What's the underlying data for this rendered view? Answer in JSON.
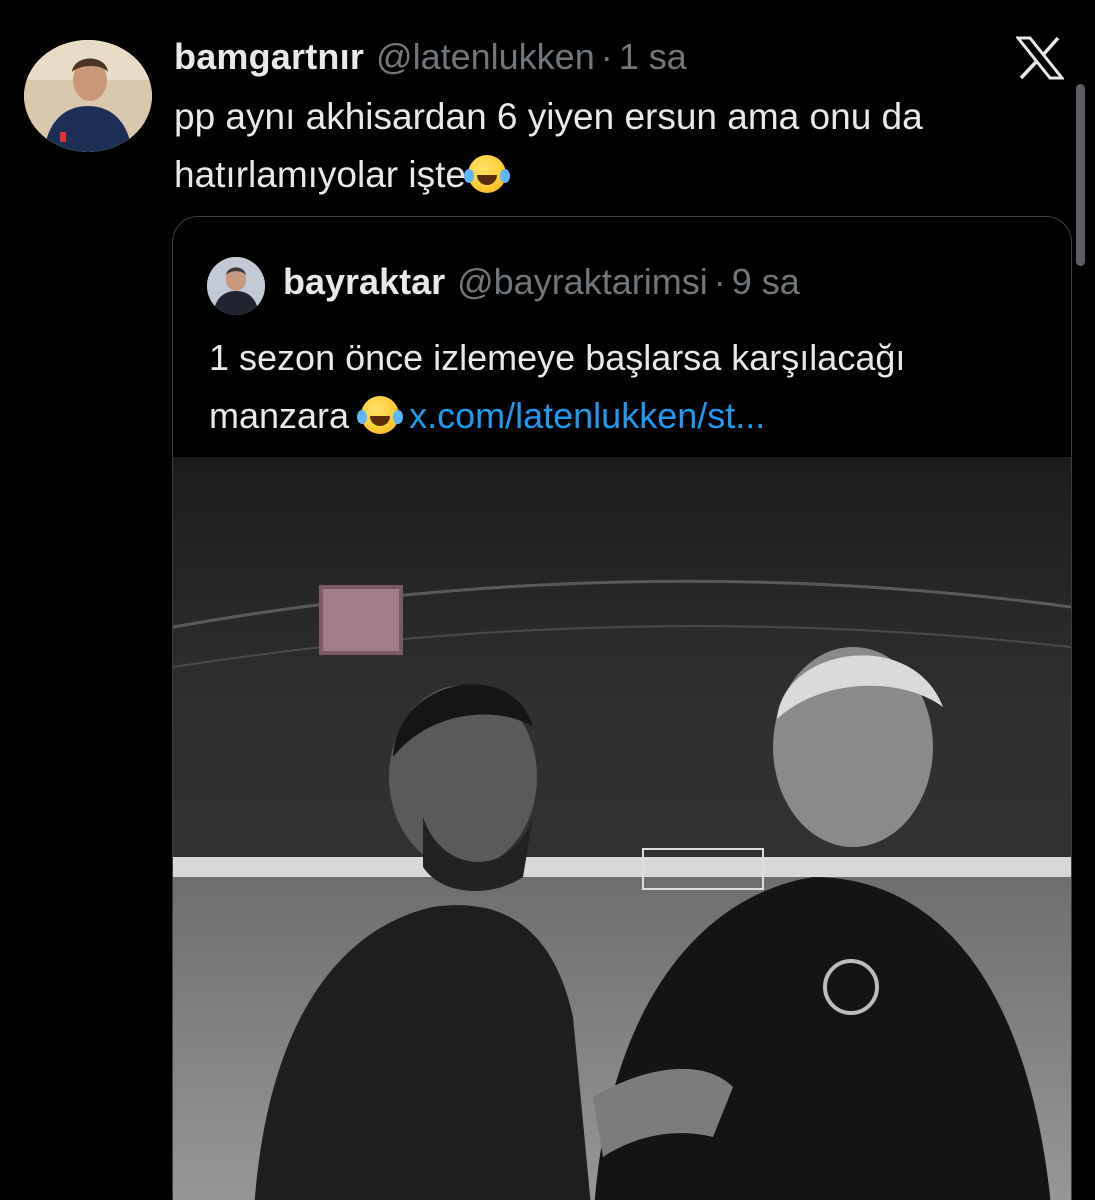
{
  "tweet": {
    "display_name": "bamgartnır",
    "handle": "@latenlukken",
    "separator": "·",
    "time": "1 sa",
    "text": "pp aynı akhisardan 6 yiyen ersun ama onu da hatırlamıyolar işte",
    "emoji": "face-with-tears-of-joy"
  },
  "quote": {
    "display_name": "bayraktar",
    "handle": "@bayraktarimsi",
    "separator": "·",
    "time": "9 sa",
    "text": "1 sezon önce izlemeye başlarsa karşılacağı manzara",
    "emoji": "face-with-tears-of-joy",
    "link": "x.com/latenlukken/st..."
  },
  "icons": {
    "brand": "x-logo-icon"
  },
  "colors": {
    "background": "#000000",
    "text": "#e7e9ea",
    "muted": "#71767b",
    "link": "#1d9bf0",
    "border": "#3a3f44"
  }
}
